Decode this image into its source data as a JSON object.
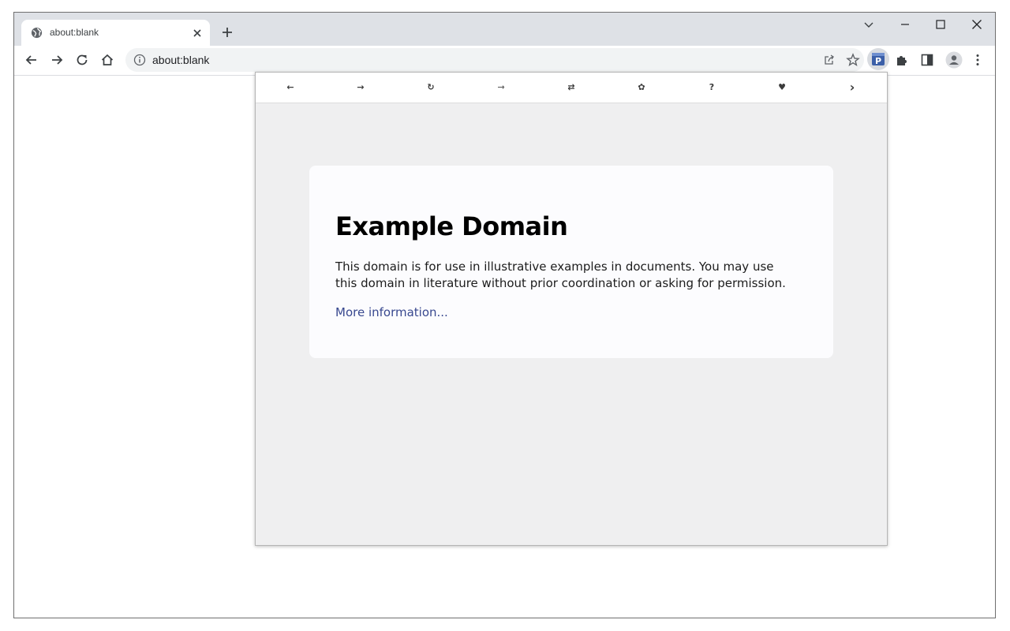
{
  "browser": {
    "tab": {
      "title": "about:blank",
      "favicon": "globe-icon"
    },
    "toolbar": {
      "url": "about:blank"
    }
  },
  "popup": {
    "nav_icons": [
      "arrow-left-icon",
      "arrow-right-icon",
      "reload-icon",
      "enter-icon",
      "swap-icon",
      "gear-icon",
      "help-icon",
      "heart-icon",
      "chevron-right-icon"
    ],
    "nav_glyphs": {
      "back": "←",
      "forward": "→",
      "reload": "↻",
      "enter": "⇾",
      "swap": "⇄",
      "settings": "✿",
      "help": "?",
      "favorite": "♥",
      "next": "›"
    },
    "page": {
      "heading": "Example Domain",
      "paragraph": "This domain is for use in illustrative examples in documents. You may use this domain in literature without prior coordination or asking for permission.",
      "link": "More information..."
    }
  },
  "colors": {
    "tabstrip": "#dee1e6",
    "popup_bg": "#efeff0",
    "card_bg": "#fcfcfe",
    "link": "#38488f"
  }
}
